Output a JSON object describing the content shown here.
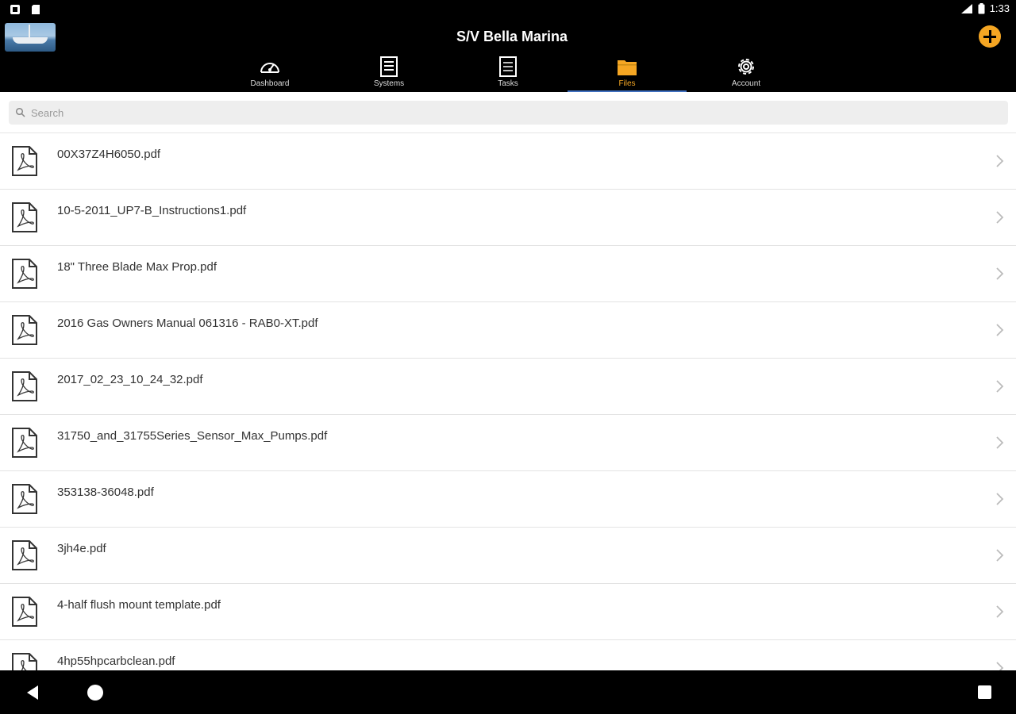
{
  "status_bar": {
    "time": "1:33"
  },
  "header": {
    "title": "S/V Bella Marina"
  },
  "tabs": [
    {
      "label": "Dashboard",
      "icon": "speedometer-icon",
      "active": false
    },
    {
      "label": "Systems",
      "icon": "list-icon",
      "active": false
    },
    {
      "label": "Tasks",
      "icon": "document-list-icon",
      "active": false
    },
    {
      "label": "Files",
      "icon": "folder-icon",
      "active": true
    },
    {
      "label": "Account",
      "icon": "gear-icon",
      "active": false
    }
  ],
  "search": {
    "placeholder": "Search",
    "value": ""
  },
  "files": [
    {
      "name": "00X37Z4H6050.pdf"
    },
    {
      "name": "10-5-2011_UP7-B_Instructions1.pdf"
    },
    {
      "name": "18\" Three Blade Max Prop.pdf"
    },
    {
      "name": "2016 Gas Owners Manual 061316 - RAB0-XT.pdf"
    },
    {
      "name": "2017_02_23_10_24_32.pdf"
    },
    {
      "name": "31750_and_31755Series_Sensor_Max_Pumps.pdf"
    },
    {
      "name": "353138-36048.pdf"
    },
    {
      "name": "3jh4e.pdf"
    },
    {
      "name": "4-half flush mount template.pdf"
    },
    {
      "name": "4hp55hpcarbclean.pdf"
    }
  ],
  "colors": {
    "accent": "#f5a623",
    "tab_indicator": "#3f6fbf",
    "bar_bg": "#000000"
  }
}
